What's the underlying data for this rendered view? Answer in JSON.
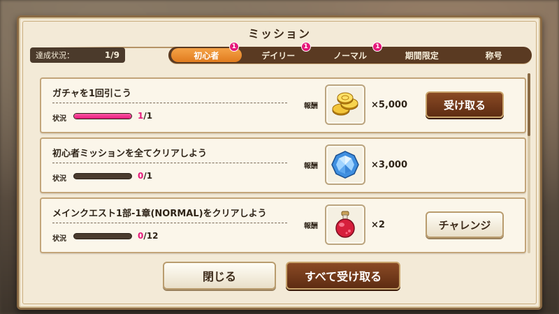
{
  "dialog": {
    "title": "ミッション",
    "progress_label": "達成状況：",
    "progress_value": "1/9"
  },
  "tabs": [
    {
      "label": "初心者",
      "badge": "1",
      "active": true
    },
    {
      "label": "デイリー",
      "badge": "1",
      "active": false
    },
    {
      "label": "ノーマル",
      "badge": "1",
      "active": false
    },
    {
      "label": "期間限定",
      "badge": "",
      "active": false
    },
    {
      "label": "称号",
      "badge": "",
      "active": false
    }
  ],
  "missions": [
    {
      "title": "ガチャを1回引こう",
      "status_label": "状況",
      "current": "1",
      "total": "/1",
      "progress": 1.0,
      "reward_label": "報酬",
      "reward_icon": "gold-coins-icon",
      "reward_qty": "×5,000",
      "button": "受け取る",
      "button_type": "receive"
    },
    {
      "title": "初心者ミッションを全てクリアしよう",
      "status_label": "状況",
      "current": "0",
      "total": "/1",
      "progress": 0.0,
      "reward_label": "報酬",
      "reward_icon": "blue-gem-icon",
      "reward_qty": "×3,000",
      "button": "",
      "button_type": "none"
    },
    {
      "title": "メインクエスト1部-1章(NORMAL)をクリアしよう",
      "status_label": "状況",
      "current": "0",
      "total": "/12",
      "progress": 0.0,
      "reward_label": "報酬",
      "reward_icon": "red-potion-icon",
      "reward_qty": "×2",
      "button": "チャレンジ",
      "button_type": "challenge"
    }
  ],
  "footer": {
    "close_label": "閉じる",
    "receive_all_label": "すべて受け取る"
  },
  "colors": {
    "accent_pink": "#e5197a",
    "tab_active": "#e07c1f",
    "button_dark": "#5e2c12"
  }
}
